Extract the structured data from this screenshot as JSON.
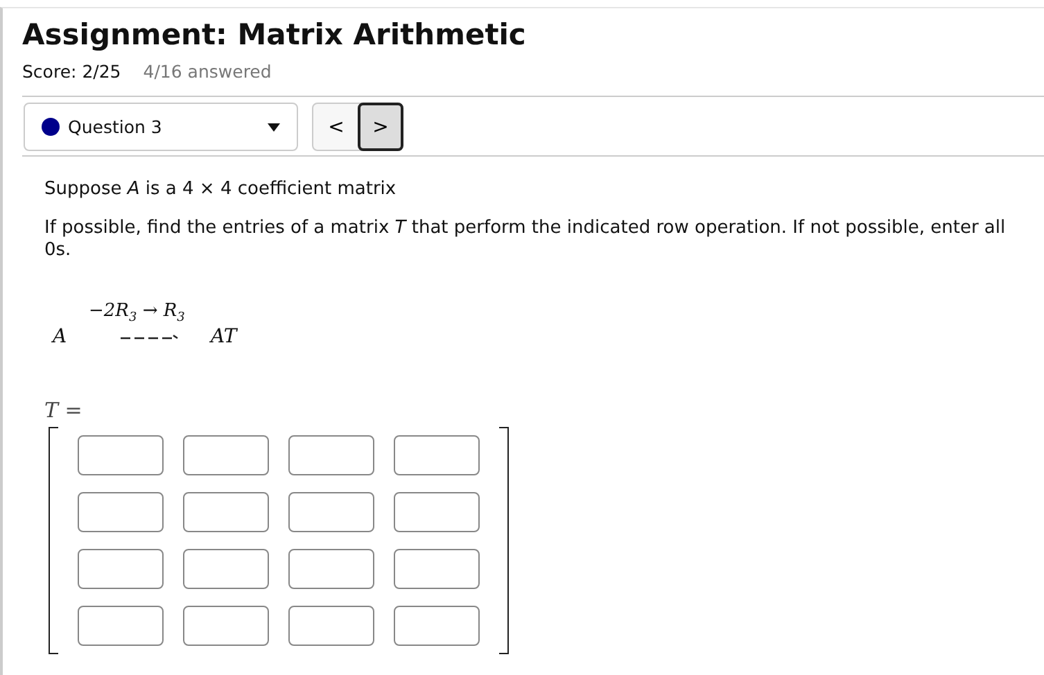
{
  "header": {
    "title": "Assignment: Matrix Arithmetic",
    "score": "Score: 2/25",
    "progress": "4/16 answered"
  },
  "question_nav": {
    "question": {
      "label": "Question 3",
      "color": "#00008b"
    },
    "buttons": [
      {
        "label": "<",
        "focused": false
      },
      {
        "label": ">",
        "focused": true
      }
    ]
  },
  "question": {
    "paragraphs": [
      "Suppose *A* is a 4 × 4 coefficient matrix",
      "If possible, find the entries of a matrix *T* that perform the indicated row operation. If not possible, enter all 0s."
    ],
    "operation": {
      "above": "−2R$_{3}$ → R$_{3}$",
      "from": "*A*",
      "to": "*AT*"
    },
    "matrix": {
      "label": "*T* =",
      "rows": [
        [
          {
            "kind": "input"
          },
          {
            "kind": "input"
          },
          {
            "kind": "input"
          },
          {
            "kind": "input"
          }
        ],
        [
          {
            "kind": "input"
          },
          {
            "kind": "input"
          },
          {
            "kind": "input"
          },
          {
            "kind": "input"
          }
        ],
        [
          {
            "kind": "input"
          },
          {
            "kind": "input"
          },
          {
            "kind": "input"
          },
          {
            "kind": "input"
          }
        ],
        [
          {
            "kind": "input"
          },
          {
            "kind": "input"
          },
          {
            "kind": "input"
          },
          {
            "kind": "input"
          }
        ]
      ]
    }
  }
}
